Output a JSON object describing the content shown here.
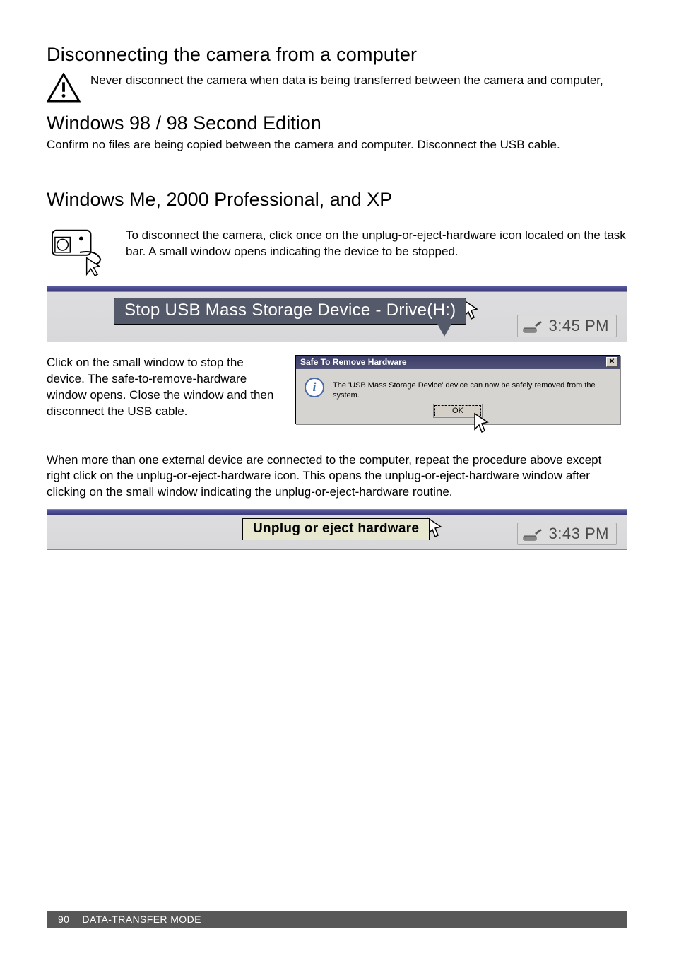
{
  "heading1": "Disconnecting the camera from a computer",
  "warning_text": "Never disconnect the camera when data is being transferred between the camera and computer,",
  "heading2": "Windows 98 / 98 Second Edition",
  "win98_text": "Confirm no files are being copied between the camera and computer. Disconnect the USB cable.",
  "heading3": "Windows Me, 2000 Professional, and XP",
  "me_2000_xp_text": "To disconnect the camera, click once on the unplug-or-eject-hardware icon located on the task bar. A small window opens indicating the device to be stopped.",
  "balloon1": "Stop USB Mass Storage Device - Drive(H:)",
  "tray_time1": "3:45 PM",
  "safe_remove_instructions": "Click on the small window to stop the device. The safe-to-remove-hardware window opens. Close the window and then disconnect the USB cable.",
  "dialog_title": "Safe To Remove Hardware",
  "dialog_message": "The 'USB Mass Storage Device' device can now be safely removed from the system.",
  "ok_label": "OK",
  "multi_device_text": "When more than one external device are connected to the computer, repeat the procedure above except right click on the unplug-or-eject-hardware icon. This opens the unplug-or-eject-hardware window after clicking on the small window indicating the unplug-or-eject-hardware routine.",
  "balloon2": "Unplug or eject hardware",
  "tray_time2": "3:43 PM",
  "footer_page": "90",
  "footer_title": "DATA-TRANSFER MODE"
}
